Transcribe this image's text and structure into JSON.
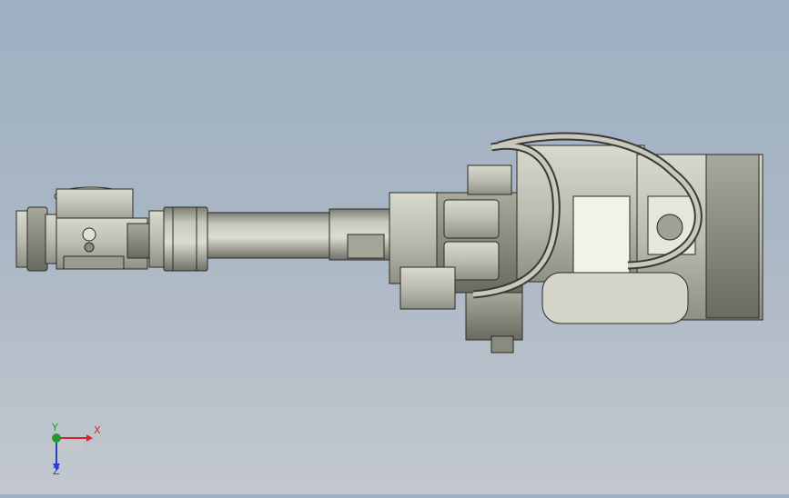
{
  "viewport": {
    "background_top": "#9fb0c3",
    "background_bottom": "#c3c8cf",
    "model_color": "#c9c9bd",
    "edge_color": "#2b2b28"
  },
  "triad": {
    "x_label": "X",
    "y_label": "Y",
    "z_label": "Z",
    "x_color": "#d8252b",
    "y_color": "#1f9b2a",
    "z_color": "#2a3fd0"
  }
}
